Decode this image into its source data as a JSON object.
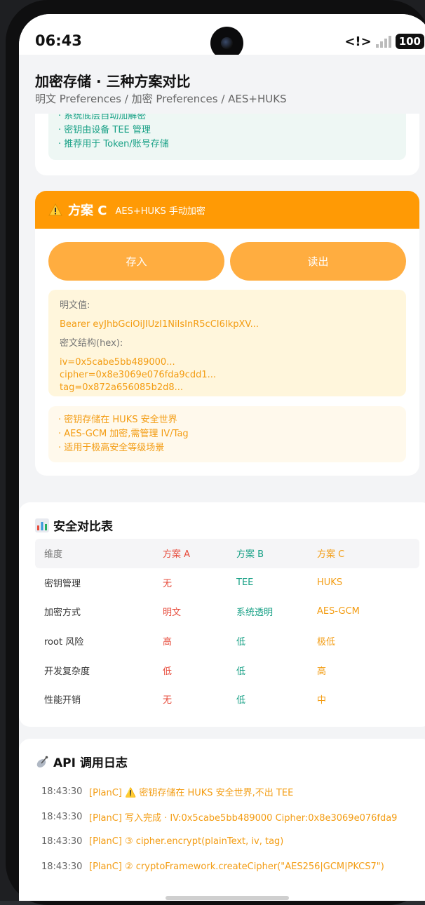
{
  "status_bar": {
    "time": "06:43",
    "battery": "100"
  },
  "header": {
    "title": "加密存储 · 三种方案对比",
    "subtitle": "明文 Preferences / 加密 Preferences / AES+HUKS"
  },
  "plan_b": {
    "bullets": [
      "· 系统底层自动加解密",
      "· 密钥由设备 TEE 管理",
      "· 推荐用于 Token/账号存储"
    ]
  },
  "plan_c": {
    "title": "方案 C",
    "subtitle": "AES+HUKS 手动加密",
    "save_label": "存入",
    "read_label": "读出",
    "plaintext_label": "明文值:",
    "plaintext_value": "Bearer eyJhbGciOiJIUzI1NiIsInR5cCI6IkpXV...",
    "cipher_label": "密文结构(hex):",
    "iv": "iv=0x5cabe5bb489000...",
    "cipher": "cipher=0x8e3069e076fda9cdd1...",
    "tag": "tag=0x872a656085b2d8...",
    "bullets": [
      "· 密钥存储在 HUKS 安全世界",
      "· AES-GCM 加密,需管理 IV/Tag",
      "· 适用于极高安全等级场景"
    ]
  },
  "compare": {
    "title": "安全对比表",
    "headers": [
      "维度",
      "方案 A",
      "方案 B",
      "方案 C"
    ],
    "rows": [
      [
        "密钥管理",
        "无",
        "TEE",
        "HUKS"
      ],
      [
        "加密方式",
        "明文",
        "系统透明",
        "AES-GCM"
      ],
      [
        "root 风险",
        "高",
        "低",
        "极低"
      ],
      [
        "开发复杂度",
        "低",
        "低",
        "高"
      ],
      [
        "性能开销",
        "无",
        "低",
        "中"
      ]
    ],
    "colors": {
      "plan_a": "#e74c3c",
      "plan_b": "#16a085",
      "plan_c": "#f39c12"
    }
  },
  "logs": {
    "title": "API 调用日志",
    "entries": [
      {
        "time": "18:43:30",
        "message": "[PlanC] ⚠️ 密钥存储在 HUKS 安全世界,不出 TEE"
      },
      {
        "time": "18:43:30",
        "message": "[PlanC] 写入完成 · IV:0x5cabe5bb489000 Cipher:0x8e3069e076fda9"
      },
      {
        "time": "18:43:30",
        "message": "[PlanC] ③ cipher.encrypt(plainText, iv, tag)"
      },
      {
        "time": "18:43:30",
        "message": "[PlanC] ② cryptoFramework.createCipher(\"AES256|GCM|PKCS7\")"
      }
    ]
  },
  "accent": "#ff9a05"
}
